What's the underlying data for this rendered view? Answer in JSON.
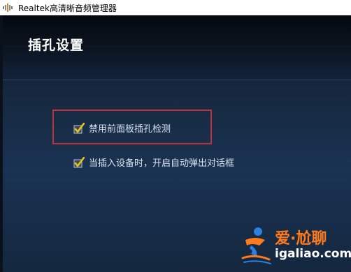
{
  "window": {
    "title": "Realtek高清晰音频管理器",
    "icon": "speaker-icon"
  },
  "page": {
    "section_title": "插孔设置"
  },
  "options": [
    {
      "label": "禁用前面板插孔检测",
      "checked": true,
      "highlighted": true
    },
    {
      "label": "当插入设备时，开启自动弹出对话框",
      "checked": true,
      "highlighted": false
    }
  ],
  "watermark": {
    "brand": "爱·尬聊",
    "domain": "igaliao.com"
  },
  "colors": {
    "highlight_border": "#c0303a",
    "checkmark": "#e8c21a",
    "watermark_orange": "#ff7a1a",
    "background": "#1a3352"
  }
}
